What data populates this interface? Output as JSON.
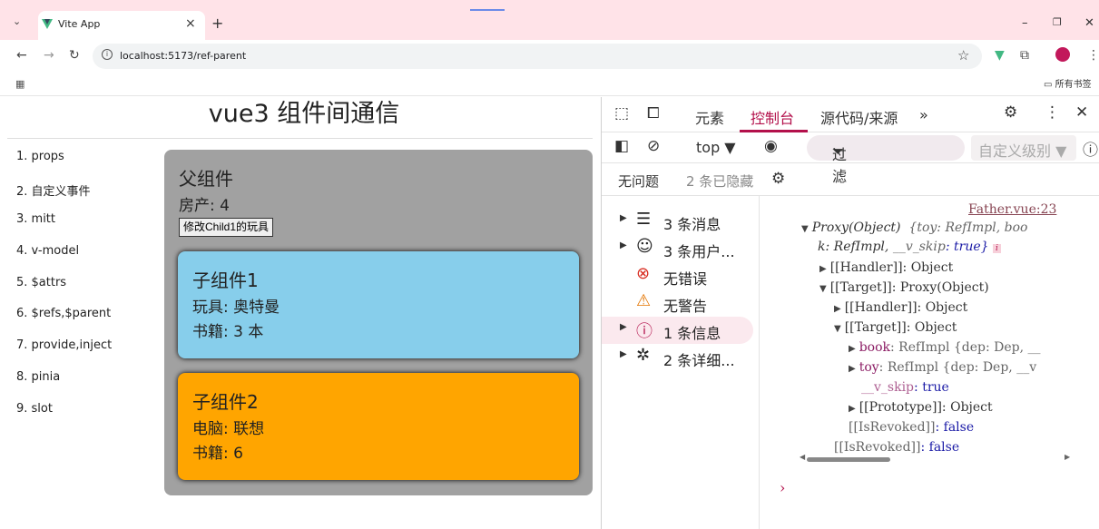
{
  "browser": {
    "tab_title": "Vite App",
    "tab_close": "×",
    "new_tab": "+",
    "url": "localhost:5173/ref-parent",
    "bookmarks_folder": "所有书签",
    "win_min": "–",
    "win_max": "❐",
    "win_close": "✕"
  },
  "page": {
    "title": "vue3 组件间通信",
    "nav": [
      "1. props",
      "2. 自定义事件",
      "3. mitt",
      "4. v-model",
      "5. $attrs",
      "6. $refs,$parent",
      "7. provide,inject",
      "8. pinia",
      "9. slot"
    ],
    "father": {
      "heading": "父组件",
      "house": "房产: 4",
      "button": "修改Child1的玩具"
    },
    "child1": {
      "heading": "子组件1",
      "toy": "玩具: 奥特曼",
      "book": "书籍: 3 本",
      "bg_color": "#87ceeb"
    },
    "child2": {
      "heading": "子组件2",
      "computer": "电脑: 联想",
      "book": "书籍: 6",
      "bg_color": "#ffa500"
    }
  },
  "devtools": {
    "tabs": [
      "元素",
      "控制台",
      "源代码/来源"
    ],
    "active_tab": "控制台",
    "more": "»",
    "context": "top ▼",
    "filter": "过滤",
    "levels": "自定义级别 ▼",
    "no_issues": "无问题",
    "hidden": "2 条已隐藏",
    "sidebar": [
      {
        "label": "3 条消息",
        "icon": "list-icon"
      },
      {
        "label": "3 条用户...",
        "icon": "user-icon"
      },
      {
        "label": "无错误",
        "icon": "error-icon"
      },
      {
        "label": "无警告",
        "icon": "warning-icon"
      },
      {
        "label": "1 条信息",
        "icon": "info-icon"
      },
      {
        "label": "2 条详细...",
        "icon": "bug-icon"
      }
    ],
    "console": {
      "source": "Father.vue:23",
      "lines": {
        "l1a": "Proxy(Object)",
        "l1b": "{toy: RefImpl, boo",
        "l2a": "k: RefImpl, ",
        "l2b": "__v_skip",
        "l2c": ": true}",
        "handler1": "[[Handler]]: Object",
        "target1": "[[Target]]: Proxy(Object)",
        "handler2": "[[Handler]]: Object",
        "target2": "[[Target]]: Object",
        "book_key": "book",
        "book_val": ": RefImpl  {dep: Dep, __",
        "toy_key": "toy",
        "toy_val": ": RefImpl  {dep: Dep, __v",
        "skip_key": "__v_skip",
        "skip_val": ": true",
        "proto": "[[Prototype]]: Object",
        "revoked1_key": "[[IsRevoked]]",
        "revoked1_val": ": false",
        "revoked2_key": "[[IsRevoked]]",
        "revoked2_val": ": false"
      },
      "prompt": "›"
    }
  }
}
